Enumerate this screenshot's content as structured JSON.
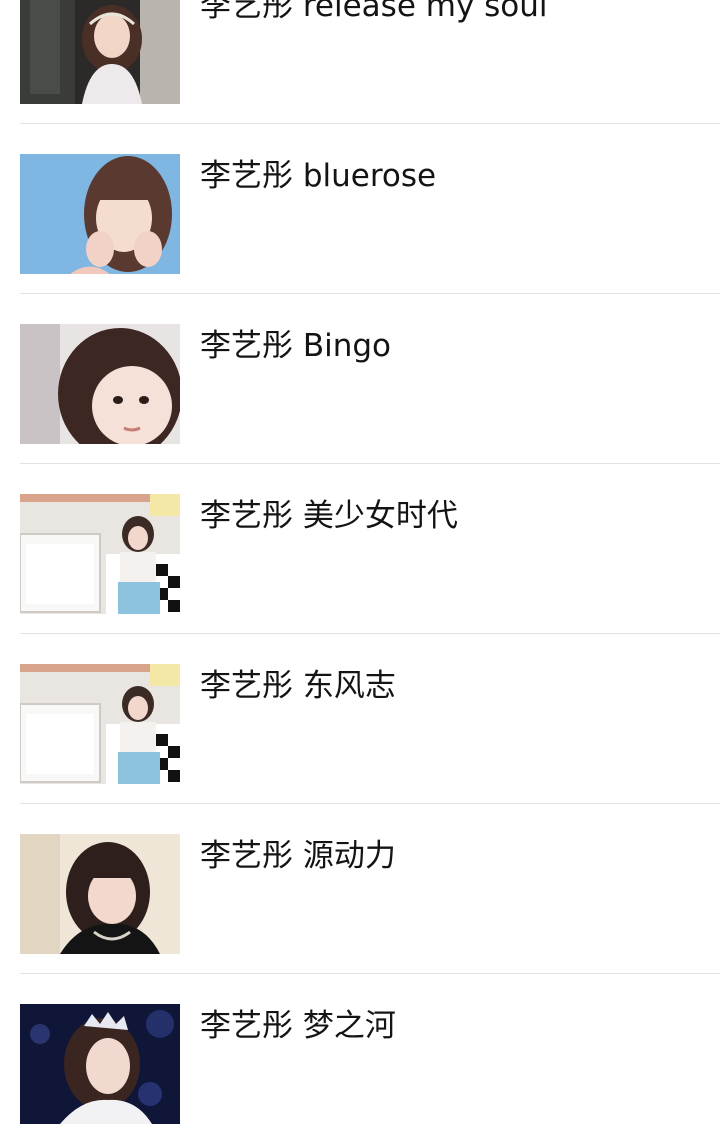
{
  "songs": [
    {
      "title": "李艺彤 release my soul",
      "thumbnail": "photo-icon"
    },
    {
      "title": "李艺彤 bluerose",
      "thumbnail": "photo-icon"
    },
    {
      "title": "李艺彤 Bingo",
      "thumbnail": "photo-icon"
    },
    {
      "title": "李艺彤 美少女时代",
      "thumbnail": "photo-icon"
    },
    {
      "title": "李艺彤 东风志",
      "thumbnail": "photo-icon"
    },
    {
      "title": "李艺彤 源动力",
      "thumbnail": "photo-icon"
    },
    {
      "title": "李艺彤 梦之河",
      "thumbnail": "photo-icon"
    }
  ]
}
